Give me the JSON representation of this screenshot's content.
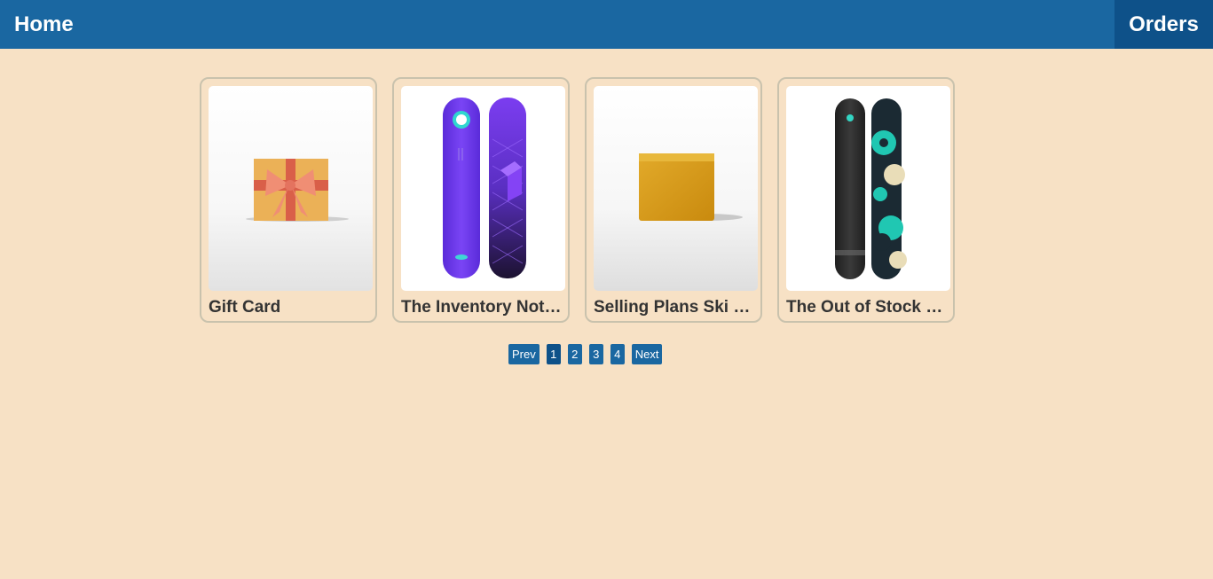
{
  "nav": {
    "home": "Home",
    "orders": "Orders"
  },
  "products": [
    {
      "title": "Gift Card",
      "image": "gift-box"
    },
    {
      "title": "The Inventory Not Tracked Snowboard",
      "image": "purple-snowboards"
    },
    {
      "title": "Selling Plans Ski Wax",
      "image": "ski-wax"
    },
    {
      "title": "The Out of Stock Snowboard",
      "image": "dark-teal-snowboards"
    }
  ],
  "pagination": {
    "prev": "Prev",
    "pages": [
      "1",
      "2",
      "3",
      "4"
    ],
    "current": "1",
    "next": "Next"
  },
  "colors": {
    "header": "#1a67a1",
    "active": "#0e5189",
    "background": "#f7e1c5"
  }
}
